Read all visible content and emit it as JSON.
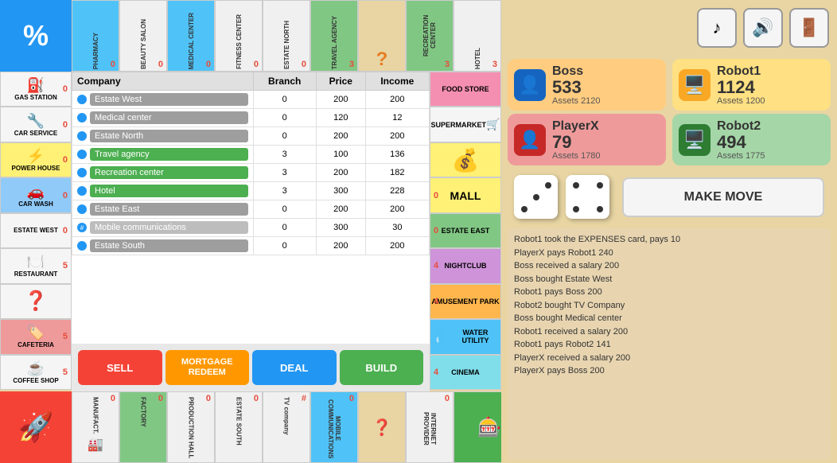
{
  "topCells": [
    {
      "name": "PHARMACY",
      "num": "0",
      "bg": "blue-bg"
    },
    {
      "name": "BEAUTY SALON",
      "num": "0",
      "bg": ""
    },
    {
      "name": "MEDICAL CENTER",
      "num": "0",
      "bg": "blue-bg"
    },
    {
      "name": "FITNESS CENTER",
      "num": "0",
      "bg": ""
    },
    {
      "name": "ESTATE NORTH",
      "num": "0",
      "bg": ""
    },
    {
      "name": "TRAVEL AGENCY",
      "num": "3",
      "bg": "green-bg"
    },
    {
      "name": "?",
      "num": "",
      "bg": "q-bg"
    },
    {
      "name": "RECREATION CENTER",
      "num": "3",
      "bg": "green-bg"
    },
    {
      "name": "HOTEL",
      "num": "3",
      "bg": ""
    }
  ],
  "leftCells": [
    {
      "name": "GAS STATION",
      "num": "0",
      "bg": "",
      "icon": "⛽"
    },
    {
      "name": "CAR SERVICE",
      "num": "0",
      "bg": "service-bg",
      "icon": "🔧"
    },
    {
      "name": "POWER HOUSE",
      "num": "0",
      "bg": "yellow-bg",
      "icon": "⚡"
    },
    {
      "name": "CAR WASH",
      "num": "0",
      "bg": "blue-cell",
      "icon": "🚗"
    },
    {
      "name": "ESTATE WEST",
      "num": "0",
      "bg": ""
    },
    {
      "name": "RESTAURANT",
      "num": "5",
      "bg": ""
    },
    {
      "name": "?",
      "num": "",
      "bg": "",
      "icon": "❓"
    },
    {
      "name": "CAFETERIA",
      "num": "5",
      "bg": "red-bg",
      "icon": "🏷️"
    },
    {
      "name": "COFFEE SHOP",
      "num": "5",
      "bg": ""
    }
  ],
  "bottomCells": [
    {
      "name": "MANUFACT...",
      "num": "0",
      "bg": ""
    },
    {
      "name": "FACTORY",
      "num": "0",
      "bg": "green-b"
    },
    {
      "name": "PRODUCTION HALL",
      "num": "0",
      "bg": ""
    },
    {
      "name": "ESTATE SOUTH",
      "num": "0",
      "bg": ""
    },
    {
      "name": "TV company",
      "num": "#",
      "bg": ""
    },
    {
      "name": "MOBILE COMMUNICATIONS",
      "num": "0",
      "bg": "blue-b"
    },
    {
      "name": "?",
      "num": "",
      "bg": "q-b"
    },
    {
      "name": "INTERNET PROVIDER",
      "num": "0",
      "bg": ""
    }
  ],
  "rightSideCells": [
    {
      "name": "FOOD STORE",
      "numLeft": "",
      "numRight": "",
      "bg": "pink-bg"
    },
    {
      "name": "SUPERMARKET",
      "numLeft": "",
      "numRight": "",
      "bg": ""
    },
    {
      "name": "IMAGE",
      "numLeft": "",
      "numRight": "",
      "bg": "yellow-bg"
    },
    {
      "name": "MALL",
      "numLeft": "0",
      "numRight": "",
      "bg": "yellow-bg"
    },
    {
      "name": "ESTATE EAST",
      "numLeft": "0",
      "numRight": "",
      "bg": "green-rs"
    },
    {
      "name": "NIGHTCLUB",
      "numLeft": "4",
      "numRight": "",
      "bg": "purple-rs"
    },
    {
      "name": "AMUSEMENT PARK",
      "numLeft": "4",
      "numRight": "",
      "bg": "orange-rs"
    },
    {
      "name": "WATER UTILITY",
      "numLeft": "",
      "numRight": "",
      "bg": "blue-rs"
    },
    {
      "name": "CINEMA",
      "numLeft": "4",
      "numRight": "",
      "bg": "cyan-rs"
    }
  ],
  "table": {
    "headers": [
      "Company",
      "Branch",
      "Price",
      "Income"
    ],
    "rows": [
      {
        "dot": "blue",
        "name": "Estate West",
        "style": "gray",
        "branch": "0",
        "price": "200",
        "income": "200"
      },
      {
        "dot": "blue",
        "name": "Medical center",
        "style": "gray",
        "branch": "0",
        "price": "120",
        "income": "12"
      },
      {
        "dot": "blue",
        "name": "Estate North",
        "style": "gray",
        "branch": "0",
        "price": "200",
        "income": "200"
      },
      {
        "dot": "blue",
        "name": "Travel agency",
        "style": "green",
        "branch": "3",
        "price": "100",
        "income": "136"
      },
      {
        "dot": "blue",
        "name": "Recreation center",
        "style": "green",
        "branch": "3",
        "price": "200",
        "income": "182"
      },
      {
        "dot": "blue",
        "name": "Hotel",
        "style": "green",
        "branch": "3",
        "price": "300",
        "income": "228"
      },
      {
        "dot": "blue",
        "name": "Estate East",
        "style": "gray",
        "branch": "0",
        "price": "200",
        "income": "200"
      },
      {
        "dot": "hash",
        "name": "Mobile communications",
        "style": "light",
        "branch": "0",
        "price": "300",
        "income": "30"
      },
      {
        "dot": "blue",
        "name": "Estate South",
        "style": "gray",
        "branch": "0",
        "price": "200",
        "income": "200"
      }
    ]
  },
  "scoreRow": [
    "0",
    "0",
    "0",
    "0",
    "#",
    "0"
  ],
  "buttons": {
    "sell": "SELL",
    "mortgage": "MORTGAGE\nREDEEM",
    "deal": "DEAL",
    "build": "BUILD"
  },
  "players": {
    "boss": {
      "name": "Boss",
      "balance": "533",
      "assets": "Assets 2120"
    },
    "robot1": {
      "name": "Robot1",
      "balance": "1124",
      "assets": "Assets 1200"
    },
    "playerx": {
      "name": "PlayerX",
      "balance": "79",
      "assets": "Assets 1780"
    },
    "robot2": {
      "name": "Robot2",
      "balance": "494",
      "assets": "Assets 1775"
    }
  },
  "makeMoveLabel": "MAKE MOVE",
  "icons": {
    "music": "♪",
    "volume": "🔊",
    "exit": "🚪"
  },
  "log": [
    "Robot1 took the EXPENSES card, pays 10",
    "PlayerX pays Robot1 240",
    "Boss received a salary 200",
    "Boss bought Estate West",
    "Robot1 pays Boss 200",
    "Robot2 bought TV Company",
    "Boss bought Medical center",
    "Robot1 received a salary 200",
    "Robot1 pays Robot2 141",
    "PlayerX received a salary 200",
    "PlayerX pays Boss 200"
  ],
  "bottomCornerIcon": "🚀",
  "topCornerIcon": "%",
  "bottomRightCellIcon": "🎰"
}
